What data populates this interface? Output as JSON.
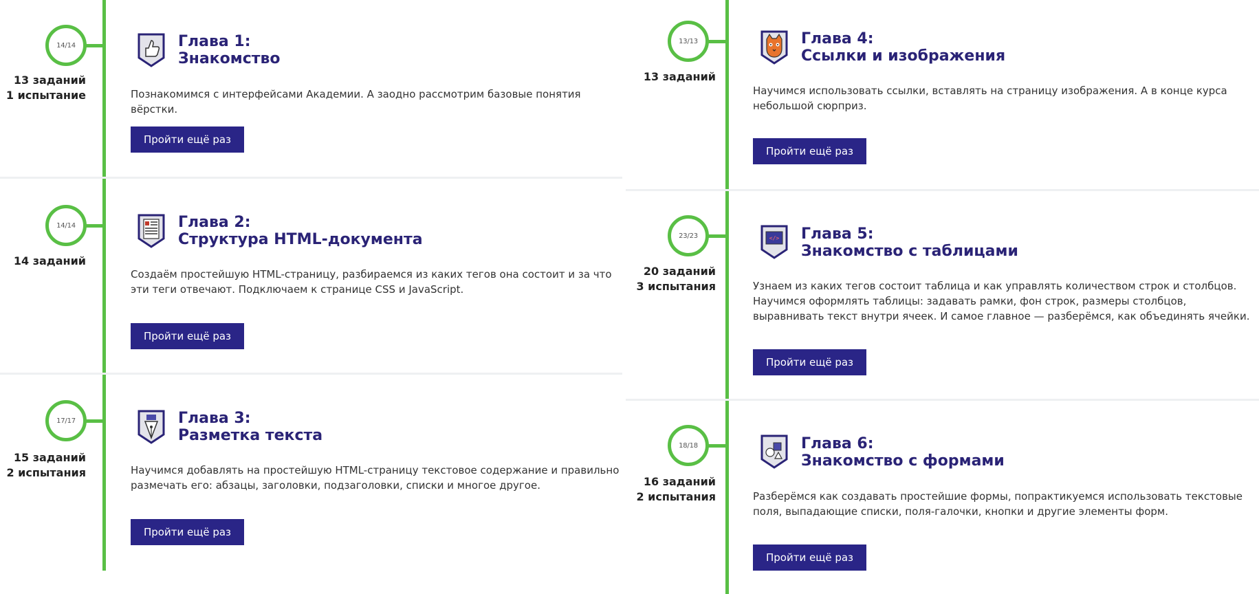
{
  "button_label": "Пройти ещё раз",
  "colors": {
    "accent_green": "#59bf45",
    "brand_purple": "#2a2587",
    "title_purple": "#2a2376"
  },
  "chapters": [
    {
      "progress": "14/14",
      "stats": [
        "13 заданий",
        "1 испытание"
      ],
      "title_line1": "Глава 1:",
      "title_line2": "Знакомство",
      "description": "Познакомимся с интерфейсами Академии. А заодно рассмотрим базовые понятия вёрстки.",
      "icon": "thumbs-up-icon"
    },
    {
      "progress": "14/14",
      "stats": [
        "14 заданий"
      ],
      "title_line1": "Глава 2:",
      "title_line2": "Структура HTML-документа",
      "description": "Создаём простейшую HTML-страницу, разбираемся из каких тегов она состоит и за что эти теги отвечают. Подключаем к странице CSS и JavaScript.",
      "icon": "document-icon"
    },
    {
      "progress": "17/17",
      "stats": [
        "15 заданий",
        "2 испытания"
      ],
      "title_line1": "Глава 3:",
      "title_line2": "Разметка текста",
      "description": "Научимся добавлять на простейшую HTML-страницу текстовое содержание и правильно размечать его: абзацы, заголовки, подзаголовки, списки и многое другое.",
      "icon": "pen-nib-icon"
    },
    {
      "progress": "13/13",
      "stats": [
        "13 заданий"
      ],
      "title_line1": "Глава 4:",
      "title_line2": "Ссылки и изображения",
      "description": "Научимся использовать ссылки, вставлять на страницу изображения. А в конце курса небольшой сюрприз.",
      "icon": "cat-icon"
    },
    {
      "progress": "23/23",
      "stats": [
        "20 заданий",
        "3 испытания"
      ],
      "title_line1": "Глава 5:",
      "title_line2": "Знакомство с таблицами",
      "description": "Узнаем из каких тегов состоит таблица и как управлять количеством строк и столбцов. Научимся оформлять таблицы: задавать рамки, фон строк, размеры столбцов, выравнивать текст внутри ячеек. И самое главное — разберёмся, как объединять ячейки.",
      "icon": "code-screen-icon"
    },
    {
      "progress": "18/18",
      "stats": [
        "16 заданий",
        "2 испытания"
      ],
      "title_line1": "Глава 6:",
      "title_line2": "Знакомство с формами",
      "description": "Разберёмся как создавать простейшие формы, попрактикуемся использовать текстовые поля, выпадающие списки, поля-галочки, кнопки и другие элементы форм.",
      "icon": "shapes-icon"
    }
  ]
}
